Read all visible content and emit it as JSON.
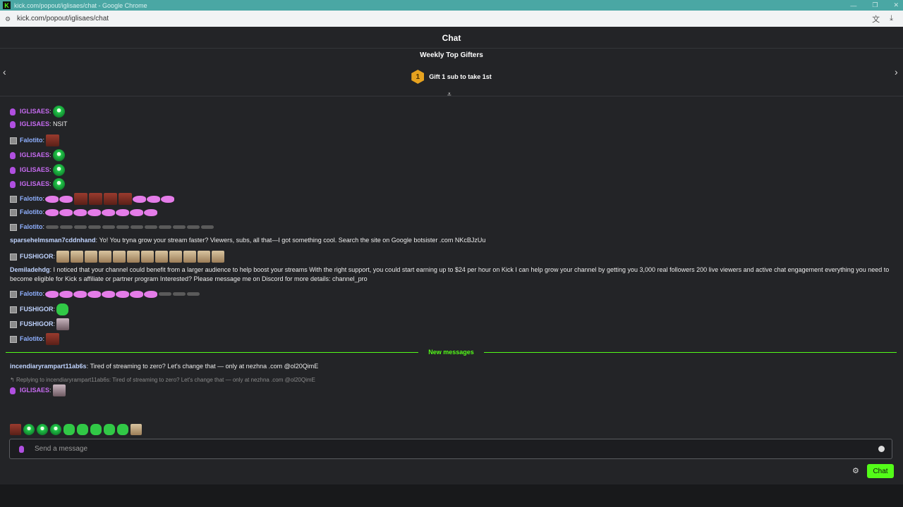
{
  "window": {
    "title": "kick.com/popout/iglisaes/chat - Google Chrome",
    "url": "kick.com/popout/iglisaes/chat"
  },
  "header": {
    "title": "Chat"
  },
  "gifters": {
    "title": "Weekly Top Gifters",
    "rank": "1",
    "text": "Gift 1 sub to take 1st"
  },
  "messages": [
    {
      "user": "IGLISAES",
      "text": ""
    },
    {
      "user": "IGLISAES",
      "text": "NSIT"
    },
    {
      "user": "Falotito",
      "text": ""
    },
    {
      "user": "IGLISAES",
      "text": ""
    },
    {
      "user": "IGLISAES",
      "text": ""
    },
    {
      "user": "IGLISAES",
      "text": ""
    },
    {
      "user": "Falotito",
      "text": ""
    },
    {
      "user": "Falotito",
      "text": ""
    },
    {
      "user": "Falotito",
      "text": ""
    },
    {
      "user": "sparsehelmsman7cddnhand",
      "text": "Yo! You tryna grow your stream faster? Viewers, subs, all that—I got something cool. Search the site on Google botsister .com NKcBJzUu"
    },
    {
      "user": "FUSHIGOR",
      "text": ""
    },
    {
      "user": "Demiladehdg",
      "text": "I noticed that your channel could benefit from a larger audience to help boost your streams With the right support, you could start earning up to $24 per hour on Kick I can help grow your channel by getting you 3,000 real followers 200 live viewers and active chat engagement everything you need to become eligible for Kick s affiliate or partner program Interested? Please message me on Discord for more details: channel_pro"
    },
    {
      "user": "Falotito",
      "text": ""
    },
    {
      "user": "FUSHIGOR",
      "text": ""
    },
    {
      "user": "FUSHIGOR",
      "text": ""
    },
    {
      "user": "Falotito",
      "text": ""
    }
  ],
  "new_messages_label": "New messages",
  "after": {
    "msg_user": "incendiaryrampart11ab6s",
    "msg_text": "Tired of streaming to zero? Let's change that — only at nezhna .com @ol20QimE",
    "reply_text": "Replying to incendiaryrampart11ab6s: Tired of streaming to zero? Let's change that — only at nezhna .com @ol20QimE",
    "reply_user": "IGLISAES"
  },
  "input": {
    "placeholder": "Send a message"
  },
  "send_button": "Chat",
  "sep": ":"
}
